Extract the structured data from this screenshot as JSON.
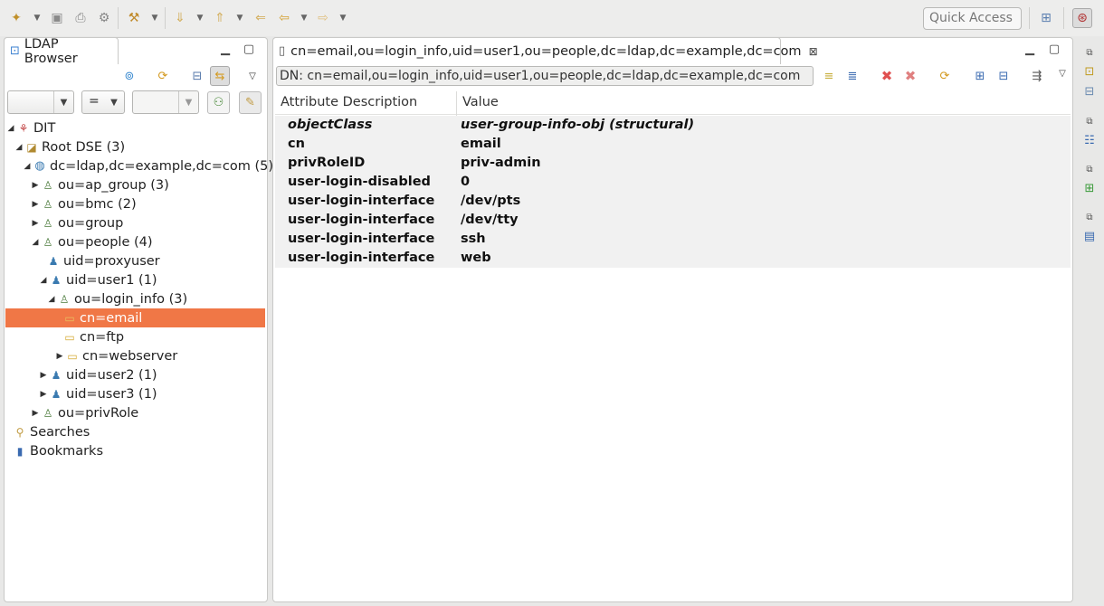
{
  "toolbar": {
    "quick_access": "Quick Access",
    "icons": [
      "new-icon",
      "save-icon",
      "print-icon",
      "gear-icon",
      "wand-icon",
      "next-annotation-icon",
      "prev-annotation-icon",
      "last-edit-icon",
      "back-icon",
      "forward-icon",
      "open-perspective-icon",
      "ldap-perspective-icon"
    ]
  },
  "browser": {
    "tab_label": "LDAP Browser",
    "filter": {
      "attribute": "",
      "operator": "=",
      "value": ""
    },
    "tree": [
      {
        "label": "DIT",
        "level": 0,
        "expanded": true,
        "icon": "dit-icon"
      },
      {
        "label": "Root DSE (3)",
        "level": 1,
        "expanded": true,
        "icon": "root-dse-icon"
      },
      {
        "label": "dc=ldap,dc=example,dc=com (5)",
        "level": 2,
        "expanded": true,
        "icon": "globe-icon"
      },
      {
        "label": "ou=ap_group (3)",
        "level": 3,
        "expanded": false,
        "icon": "ou-icon"
      },
      {
        "label": "ou=bmc (2)",
        "level": 3,
        "expanded": false,
        "icon": "ou-icon"
      },
      {
        "label": "ou=group",
        "level": 3,
        "expanded": false,
        "icon": "ou-icon"
      },
      {
        "label": "ou=people (4)",
        "level": 3,
        "expanded": true,
        "icon": "ou-icon"
      },
      {
        "label": "uid=proxyuser",
        "level": 4,
        "expanded": null,
        "icon": "user-icon"
      },
      {
        "label": "uid=user1 (1)",
        "level": 4,
        "expanded": true,
        "icon": "user-icon"
      },
      {
        "label": "ou=login_info (3)",
        "level": 5,
        "expanded": true,
        "icon": "ou-icon"
      },
      {
        "label": "cn=email",
        "level": 6,
        "expanded": null,
        "icon": "folder-icon",
        "selected": true
      },
      {
        "label": "cn=ftp",
        "level": 6,
        "expanded": null,
        "icon": "folder-icon"
      },
      {
        "label": "cn=webserver",
        "level": 6,
        "expanded": false,
        "icon": "folder-icon"
      },
      {
        "label": "uid=user2 (1)",
        "level": 4,
        "expanded": false,
        "icon": "user-icon"
      },
      {
        "label": "uid=user3 (1)",
        "level": 4,
        "expanded": false,
        "icon": "user-icon"
      },
      {
        "label": "ou=privRole",
        "level": 3,
        "expanded": false,
        "icon": "ou-icon"
      },
      {
        "label": "Searches",
        "level": 0,
        "expanded": null,
        "icon": "searches-icon"
      },
      {
        "label": "Bookmarks",
        "level": 0,
        "expanded": null,
        "icon": "bookmarks-icon"
      }
    ]
  },
  "editor": {
    "tab_label": "cn=email,ou=login_info,uid=user1,ou=people,dc=ldap,dc=example,dc=com",
    "dn_text": "DN: cn=email,ou=login_info,uid=user1,ou=people,dc=ldap,dc=example,dc=com",
    "columns": [
      "Attribute Description",
      "Value"
    ],
    "rows": [
      {
        "attribute": "objectClass",
        "value": "user-group-info-obj (structural)",
        "italic": true
      },
      {
        "attribute": "cn",
        "value": "email"
      },
      {
        "attribute": "privRoleID",
        "value": "priv-admin"
      },
      {
        "attribute": "user-login-disabled",
        "value": "0"
      },
      {
        "attribute": "user-login-interface",
        "value": "/dev/pts"
      },
      {
        "attribute": "user-login-interface",
        "value": "/dev/tty"
      },
      {
        "attribute": "user-login-interface",
        "value": "ssh"
      },
      {
        "attribute": "user-login-interface",
        "value": "web"
      }
    ]
  },
  "colors": {
    "selection": "#f07746",
    "window_bg": "#e8e8e7",
    "delete_red": "#e05050"
  }
}
